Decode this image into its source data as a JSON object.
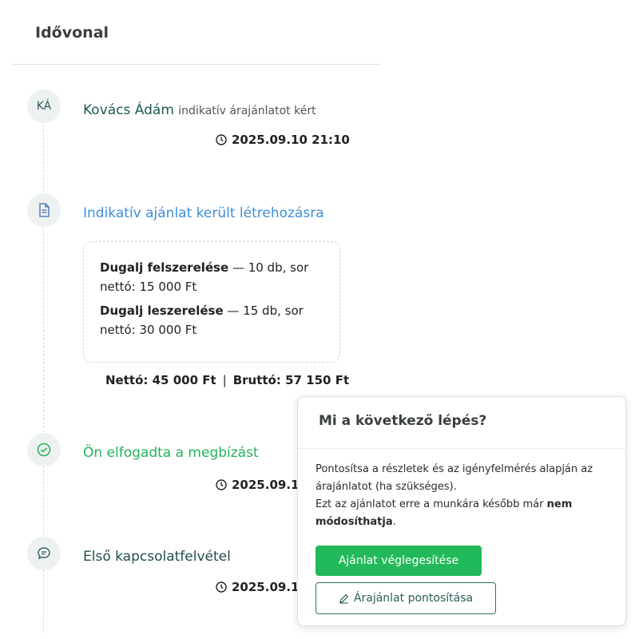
{
  "header": {
    "title": "Idővonal"
  },
  "timeline": {
    "event1": {
      "avatar_initials": "KÁ",
      "user": "Kovács Ádám",
      "action": "indikatív árajánlatot kért",
      "timestamp": "2025.09.10 21:10"
    },
    "event2": {
      "icon": "document-icon",
      "title": "Indikatív ajánlat került létrehozásra",
      "items": [
        {
          "name": "Dugalj felszerelése",
          "detail": "— 10 db, sor",
          "net": "nettó: 15 000 Ft"
        },
        {
          "name": "Dugalj leszerelése",
          "detail": "— 15 db, sor",
          "net": "nettó: 30 000 Ft"
        }
      ],
      "net_total": "Nettó: 45 000 Ft",
      "separator": "|",
      "gross_total": "Bruttó: 57 150 Ft"
    },
    "event3": {
      "icon": "check-circle-icon",
      "title": "Ön elfogadta a megbízást",
      "timestamp": "2025.09.10"
    },
    "event4": {
      "icon": "chat-bubble-icon",
      "title": "Első kapcsolatfelvétel",
      "timestamp": "2025.09.10"
    }
  },
  "popup": {
    "title": "Mi a következő lépés?",
    "text_line1": "Pontosítsa a részletek és az igényfelmérés alapján az árajánlatot (ha szükséges).",
    "text_line2_prefix": "Ezt az ajánlatot erre a munkára később már",
    "text_line2_bold": "nem módosíthatja",
    "text_line2_suffix": ".",
    "primary_button": "Ajánlat véglegesítése",
    "secondary_button": "Árajánlat pontosítása",
    "secondary_icon": "edit-icon"
  },
  "colors": {
    "green": "#22b95a",
    "blue": "#3d8fd9",
    "teal": "#1f5a54"
  }
}
